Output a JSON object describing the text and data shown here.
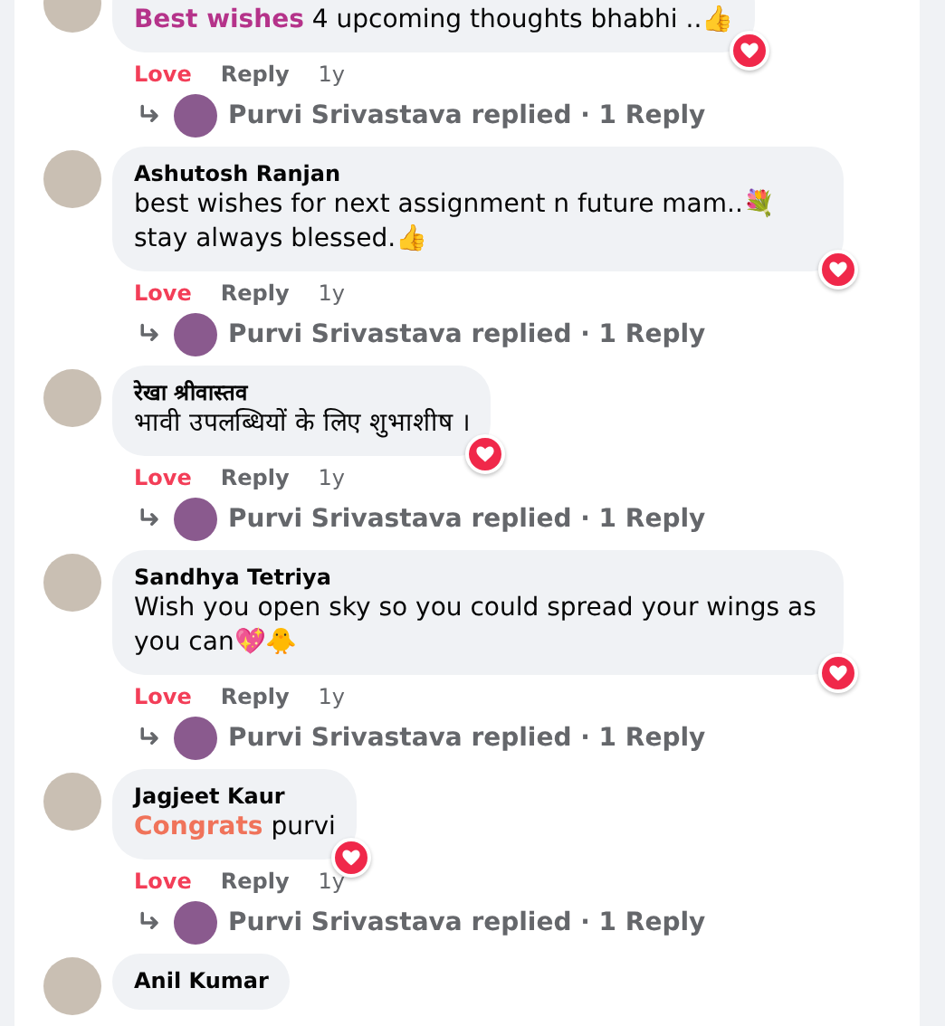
{
  "comments": [
    {
      "body": [
        {
          "kind": "highlight",
          "text": "Best wishes",
          "color": "#b5338a"
        },
        {
          "kind": "plain",
          "text": " 4 upcoming thoughts bhabhi ..👍"
        }
      ],
      "reaction": true,
      "actions": {
        "love": "Love",
        "loved": true,
        "reply": "Reply",
        "time": "1y"
      },
      "replies": {
        "text": "Purvi Srivastava replied · 1 Reply"
      }
    },
    {
      "author": "Ashutosh Ranjan",
      "body": [
        {
          "kind": "plain",
          "text": "best wishes for next assignment n future mam..💐stay always blessed.👍"
        }
      ],
      "reaction": true,
      "actions": {
        "love": "Love",
        "loved": true,
        "reply": "Reply",
        "time": "1y"
      },
      "replies": {
        "text": "Purvi Srivastava replied · 1 Reply"
      }
    },
    {
      "author": "रेखा श्रीवास्तव",
      "body": [
        {
          "kind": "plain",
          "text": "भावी उपलब्धियों के लिए शुभाशीष ।"
        }
      ],
      "reaction": true,
      "actions": {
        "love": "Love",
        "loved": true,
        "reply": "Reply",
        "time": "1y"
      },
      "replies": {
        "text": "Purvi Srivastava replied · 1 Reply"
      }
    },
    {
      "author": "Sandhya Tetriya",
      "body": [
        {
          "kind": "plain",
          "text": "Wish you open sky so you could spread your wings as you can💖🐥"
        }
      ],
      "reaction": true,
      "actions": {
        "love": "Love",
        "loved": true,
        "reply": "Reply",
        "time": "1y"
      },
      "replies": {
        "text": "Purvi Srivastava replied · 1 Reply"
      }
    },
    {
      "author": "Jagjeet Kaur",
      "body": [
        {
          "kind": "highlight",
          "text": "Congrats",
          "color": "#f0735a"
        },
        {
          "kind": "plain",
          "text": " purvi"
        }
      ],
      "reaction": true,
      "actions": {
        "love": "Love",
        "loved": true,
        "reply": "Reply",
        "time": "1y"
      },
      "replies": {
        "text": "Purvi Srivastava replied · 1 Reply"
      }
    },
    {
      "author": "Anil Kumar"
    }
  ]
}
